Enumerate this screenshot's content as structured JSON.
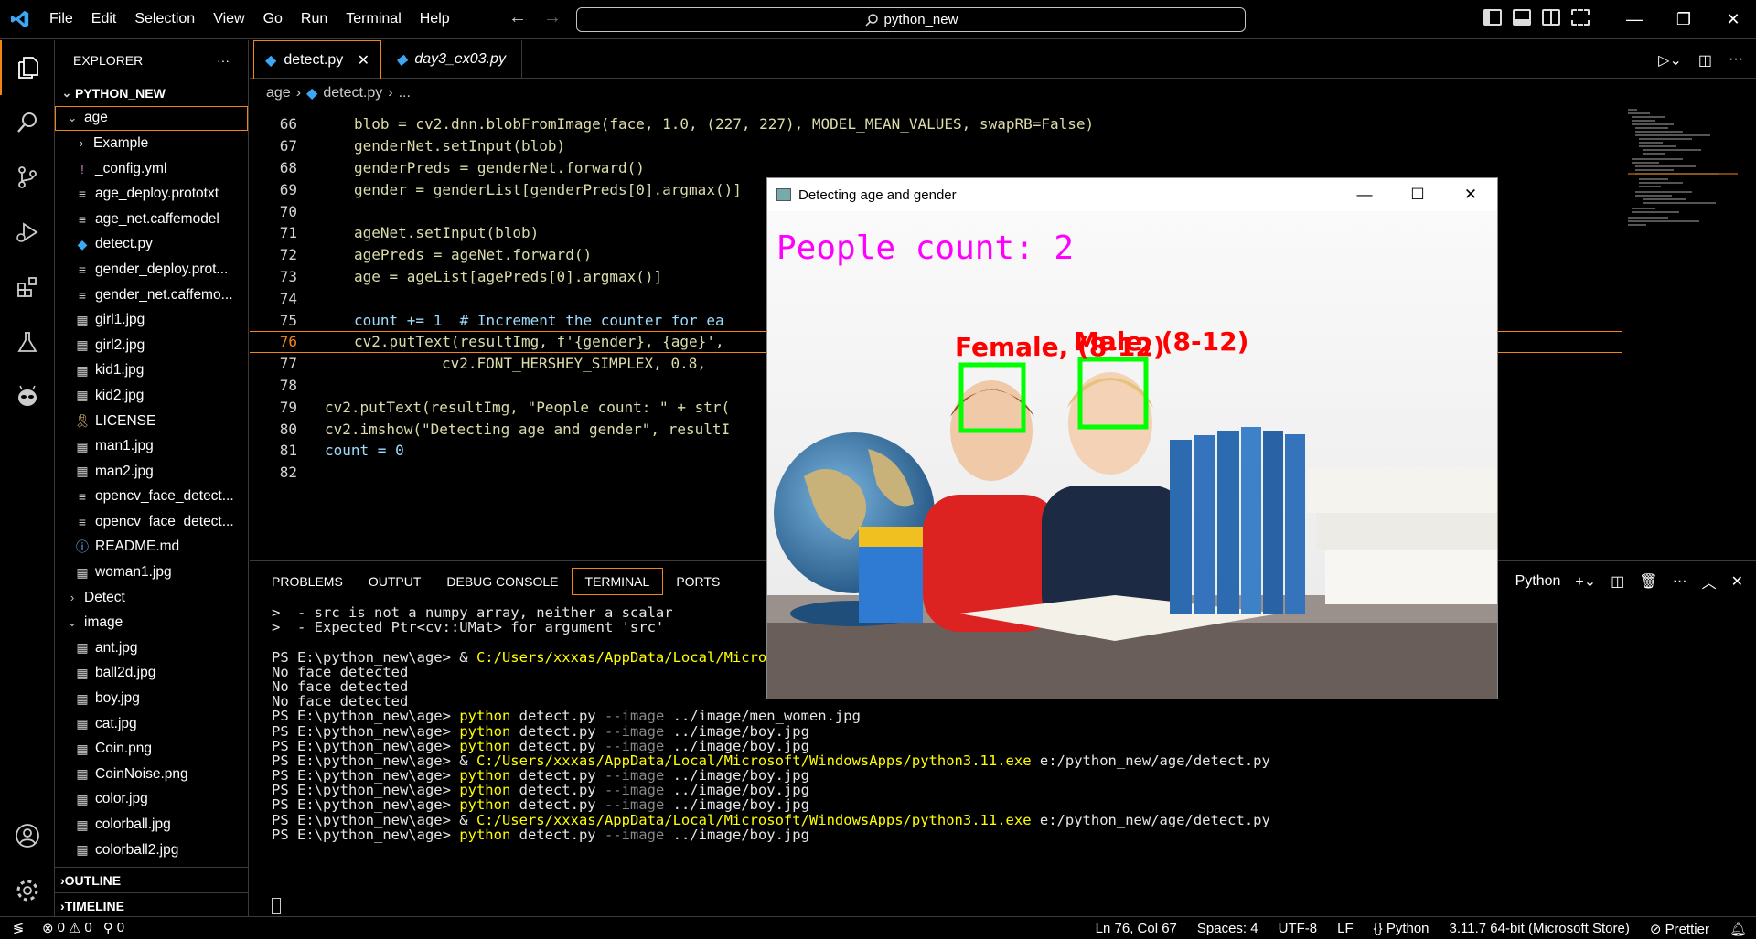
{
  "window": {
    "command_center": "python_new",
    "menu": [
      "File",
      "Edit",
      "Selection",
      "View",
      "Go",
      "Run",
      "Terminal",
      "Help"
    ]
  },
  "sidebar": {
    "title": "EXPLORER",
    "root": "PYTHON_NEW",
    "items": [
      {
        "label": "age",
        "type": "folder-open",
        "depth": 1
      },
      {
        "label": "Example",
        "type": "folder",
        "depth": 2
      },
      {
        "label": "_config.yml",
        "type": "yml",
        "depth": 2
      },
      {
        "label": "age_deploy.prototxt",
        "type": "file",
        "depth": 2
      },
      {
        "label": "age_net.caffemodel",
        "type": "file",
        "depth": 2
      },
      {
        "label": "detect.py",
        "type": "python",
        "depth": 2
      },
      {
        "label": "gender_deploy.prot...",
        "type": "file",
        "depth": 2
      },
      {
        "label": "gender_net.caffemo...",
        "type": "file",
        "depth": 2
      },
      {
        "label": "girl1.jpg",
        "type": "image",
        "depth": 2
      },
      {
        "label": "girl2.jpg",
        "type": "image",
        "depth": 2
      },
      {
        "label": "kid1.jpg",
        "type": "image",
        "depth": 2
      },
      {
        "label": "kid2.jpg",
        "type": "image",
        "depth": 2
      },
      {
        "label": "LICENSE",
        "type": "license",
        "depth": 2
      },
      {
        "label": "man1.jpg",
        "type": "image",
        "depth": 2
      },
      {
        "label": "man2.jpg",
        "type": "image",
        "depth": 2
      },
      {
        "label": "opencv_face_detect...",
        "type": "file",
        "depth": 2
      },
      {
        "label": "opencv_face_detect...",
        "type": "file",
        "depth": 2
      },
      {
        "label": "README.md",
        "type": "info",
        "depth": 2
      },
      {
        "label": "woman1.jpg",
        "type": "image",
        "depth": 2
      },
      {
        "label": "Detect",
        "type": "folder",
        "depth": 1
      },
      {
        "label": "image",
        "type": "folder-open",
        "depth": 1
      },
      {
        "label": "ant.jpg",
        "type": "image",
        "depth": 2
      },
      {
        "label": "ball2d.jpg",
        "type": "image",
        "depth": 2
      },
      {
        "label": "boy.jpg",
        "type": "image",
        "depth": 2
      },
      {
        "label": "cat.jpg",
        "type": "image",
        "depth": 2
      },
      {
        "label": "Coin.png",
        "type": "image",
        "depth": 2
      },
      {
        "label": "CoinNoise.png",
        "type": "image",
        "depth": 2
      },
      {
        "label": "color.jpg",
        "type": "image",
        "depth": 2
      },
      {
        "label": "colorball.jpg",
        "type": "image",
        "depth": 2
      },
      {
        "label": "colorball2.jpg",
        "type": "image",
        "depth": 2
      }
    ],
    "outline": "OUTLINE",
    "timeline": "TIMELINE"
  },
  "editor": {
    "tabs": [
      "detect.py",
      "day3_ex03.py"
    ],
    "breadcrumb": [
      "age",
      "detect.py",
      "..."
    ],
    "lines": [
      {
        "n": "66",
        "indent": 2,
        "text": "blob = cv2.dnn.blobFromImage(face, 1.0, (227, 227), MODEL_MEAN_VALUES, swapRB=False)"
      },
      {
        "n": "67",
        "indent": 2,
        "text": "genderNet.setInput(blob)"
      },
      {
        "n": "68",
        "indent": 2,
        "text": "genderPreds = genderNet.forward()"
      },
      {
        "n": "69",
        "indent": 2,
        "text": "gender = genderList[genderPreds[0].argmax()]"
      },
      {
        "n": "70",
        "indent": 0,
        "text": ""
      },
      {
        "n": "71",
        "indent": 2,
        "text": "ageNet.setInput(blob)"
      },
      {
        "n": "72",
        "indent": 2,
        "text": "agePreds = ageNet.forward()"
      },
      {
        "n": "73",
        "indent": 2,
        "text": "age = ageList[agePreds[0].argmax()]"
      },
      {
        "n": "74",
        "indent": 0,
        "text": ""
      },
      {
        "n": "75",
        "indent": 2,
        "text": "count += 1  # Increment the counter for ea"
      },
      {
        "n": "76",
        "indent": 2,
        "text": "cv2.putText(resultImg, f'{gender}, {age}',"
      },
      {
        "n": "77",
        "indent": 5,
        "text": "cv2.FONT_HERSHEY_SIMPLEX, 0.8,"
      },
      {
        "n": "78",
        "indent": 0,
        "text": ""
      },
      {
        "n": "79",
        "indent": 1,
        "text": "cv2.putText(resultImg, \"People count: \" + str("
      },
      {
        "n": "80",
        "indent": 1,
        "text": "cv2.imshow(\"Detecting age and gender\", resultI"
      },
      {
        "n": "81",
        "indent": 1,
        "text": "count = 0"
      },
      {
        "n": "82",
        "indent": 0,
        "text": ""
      }
    ]
  },
  "panel": {
    "tabs": [
      "PROBLEMS",
      "OUTPUT",
      "DEBUG CONSOLE",
      "TERMINAL",
      "PORTS"
    ],
    "terminal_label": "Python",
    "terminal_lines": [
      {
        "parts": [
          [
            ">  - src is not a numpy array, neither a scalar",
            ""
          ]
        ]
      },
      {
        "parts": [
          [
            ">  - Expected Ptr<cv::UMat> for argument 'src'",
            ""
          ]
        ]
      },
      {
        "parts": [
          [
            "",
            ""
          ]
        ]
      },
      {
        "parts": [
          [
            "PS E:\\python_new\\age> & ",
            ""
          ],
          [
            "C:/Users/xxxas/AppData/Local/Microso",
            "y"
          ]
        ]
      },
      {
        "parts": [
          [
            "No face detected",
            ""
          ]
        ]
      },
      {
        "parts": [
          [
            "No face detected",
            ""
          ]
        ]
      },
      {
        "parts": [
          [
            "No face detected",
            ""
          ]
        ]
      },
      {
        "parts": [
          [
            "PS E:\\python_new\\age> ",
            ""
          ],
          [
            "python",
            "y"
          ],
          [
            " detect.py ",
            ""
          ],
          [
            "--image",
            "g"
          ],
          [
            " ../image/men_women.jpg",
            ""
          ]
        ]
      },
      {
        "parts": [
          [
            "PS E:\\python_new\\age> ",
            ""
          ],
          [
            "python",
            "y"
          ],
          [
            " detect.py ",
            ""
          ],
          [
            "--image",
            "g"
          ],
          [
            " ../image/boy.jpg",
            ""
          ]
        ]
      },
      {
        "parts": [
          [
            "PS E:\\python_new\\age> ",
            ""
          ],
          [
            "python",
            "y"
          ],
          [
            " detect.py ",
            ""
          ],
          [
            "--image",
            "g"
          ],
          [
            " ../image/boy.jpg",
            ""
          ]
        ]
      },
      {
        "parts": [
          [
            "PS E:\\python_new\\age> & ",
            ""
          ],
          [
            "C:/Users/xxxas/AppData/Local/Microsoft/WindowsApps/python3.11.exe",
            "y"
          ],
          [
            " e:/python_new/age/detect.py",
            ""
          ]
        ]
      },
      {
        "parts": [
          [
            "PS E:\\python_new\\age> ",
            ""
          ],
          [
            "python",
            "y"
          ],
          [
            " detect.py ",
            ""
          ],
          [
            "--image",
            "g"
          ],
          [
            " ../image/boy.jpg",
            ""
          ]
        ]
      },
      {
        "parts": [
          [
            "PS E:\\python_new\\age> ",
            ""
          ],
          [
            "python",
            "y"
          ],
          [
            " detect.py ",
            ""
          ],
          [
            "--image",
            "g"
          ],
          [
            " ../image/boy.jpg",
            ""
          ]
        ]
      },
      {
        "parts": [
          [
            "PS E:\\python_new\\age> ",
            ""
          ],
          [
            "python",
            "y"
          ],
          [
            " detect.py ",
            ""
          ],
          [
            "--image",
            "g"
          ],
          [
            " ../image/boy.jpg",
            ""
          ]
        ]
      },
      {
        "parts": [
          [
            "PS E:\\python_new\\age> & ",
            ""
          ],
          [
            "C:/Users/xxxas/AppData/Local/Microsoft/WindowsApps/python3.11.exe",
            "y"
          ],
          [
            " e:/python_new/age/detect.py",
            ""
          ]
        ]
      },
      {
        "parts": [
          [
            "PS E:\\python_new\\age> ",
            ""
          ],
          [
            "python",
            "y"
          ],
          [
            " detect.py ",
            ""
          ],
          [
            "--image",
            "g"
          ],
          [
            " ../image/boy.jpg",
            ""
          ]
        ]
      }
    ]
  },
  "statusbar": {
    "errors": "0",
    "warnings": "0",
    "ports": "0",
    "position": "Ln 76, Col 67",
    "spaces": "Spaces: 4",
    "encoding": "UTF-8",
    "eol": "LF",
    "language": "Python",
    "interpreter": "3.11.7 64-bit (Microsoft Store)",
    "formatter": "Prettier"
  },
  "cv_window": {
    "title": "Detecting age and gender",
    "people_count": "People count: 2",
    "label_1": "Female, (8-12)",
    "label_2": "Male, (8-12)"
  },
  "colors": {
    "accent": "#f38518",
    "keyword_yellow": "#ffff00",
    "box_green": "#00ff00",
    "label_red": "#ff0000",
    "count_magenta": "#ff00ff"
  }
}
